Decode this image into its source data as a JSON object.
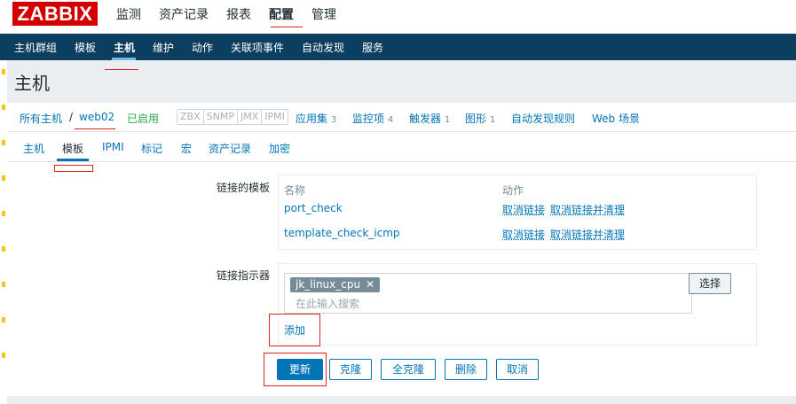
{
  "logo": "ZABBIX",
  "top_menu": [
    "监测",
    "资产记录",
    "报表",
    "配置",
    "管理"
  ],
  "top_menu_active": "配置",
  "sub_menu": [
    "主机群组",
    "模板",
    "主机",
    "维护",
    "动作",
    "关联项事件",
    "自动发现",
    "服务"
  ],
  "sub_menu_active": "主机",
  "page_title": "主机",
  "breadcrumb": {
    "all_hosts": "所有主机",
    "separator": "/",
    "host": "web02",
    "status": "已启用",
    "availability": [
      "ZBX",
      "SNMP",
      "JMX",
      "IPMI"
    ],
    "links": [
      {
        "label": "应用集",
        "count": "3"
      },
      {
        "label": "监控项",
        "count": "4"
      },
      {
        "label": "触发器",
        "count": "1"
      },
      {
        "label": "图形",
        "count": "1"
      },
      {
        "label": "自动发现规则",
        "count": ""
      },
      {
        "label": "Web 场景",
        "count": ""
      }
    ]
  },
  "tabs": [
    "主机",
    "模板",
    "IPMI",
    "标记",
    "宏",
    "资产记录",
    "加密"
  ],
  "tab_active": "模板",
  "linked_templates": {
    "label": "链接的模板",
    "col_name": "名称",
    "col_action": "动作",
    "rows": [
      {
        "name": "port_check",
        "unlink": "取消链接",
        "unlink_clear": "取消链接并清理"
      },
      {
        "name": "template_check_icmp",
        "unlink": "取消链接",
        "unlink_clear": "取消链接并清理"
      }
    ]
  },
  "link_new": {
    "label": "链接指示器",
    "selected": "jk_linux_cpu",
    "remove_glyph": "✕",
    "placeholder": "在此输入搜索",
    "select_button": "选择",
    "add_link": "添加"
  },
  "buttons": {
    "update": "更新",
    "clone": "克隆",
    "full_clone": "全克隆",
    "delete": "删除",
    "cancel": "取消"
  },
  "colors": {
    "accent": "#0275b8",
    "header": "#0b3e5f",
    "logo": "#d40000",
    "annotation": "#e0231c"
  }
}
